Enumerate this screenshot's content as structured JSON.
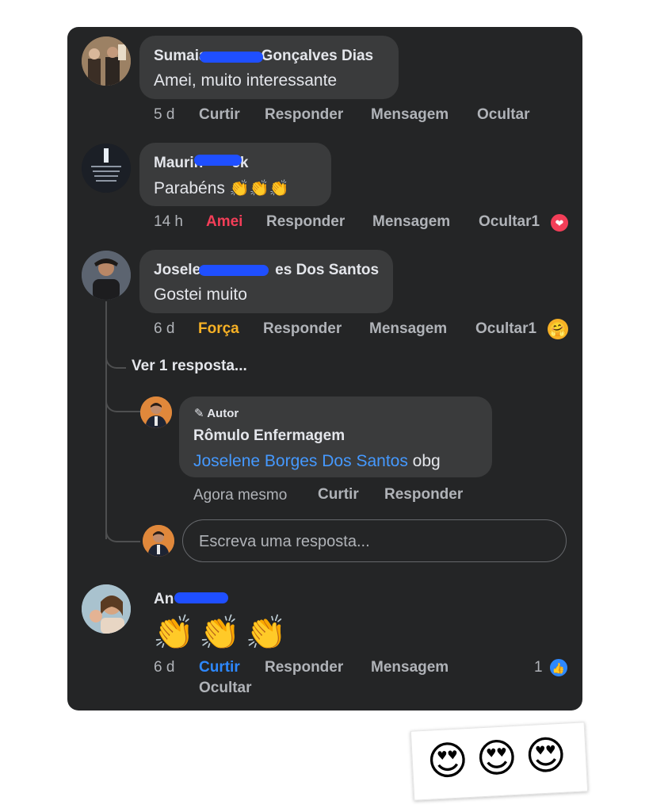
{
  "comments": [
    {
      "author": "Sumaia",
      "author_end": "Gonçalves Dias",
      "text": "Amei, muito interessante",
      "time": "5 d",
      "like_label": "Curtir",
      "reply_label": "Responder",
      "message_label": "Mensagem",
      "hide_label": "Ocultar"
    },
    {
      "author": "Maurin",
      "author_end": "ck",
      "text": "Parabéns",
      "text_emoji": "👏👏👏",
      "time": "14 h",
      "like_label": "Amei",
      "reply_label": "Responder",
      "message_label": "Mensagem",
      "hide_label": "Ocultar",
      "reaction_count": "1",
      "reaction_icon": "heart-icon"
    },
    {
      "author": "Josele",
      "author_end": "es Dos Santos",
      "text": "Gostei muito",
      "time": "6 d",
      "like_label": "Força",
      "reply_label": "Responder",
      "message_label": "Mensagem",
      "hide_label": "Ocultar",
      "reaction_count": "1",
      "reaction_icon": "hug-icon"
    },
    {
      "author": "An",
      "text_emoji": "👏👏👏",
      "time": "6 d",
      "like_label": "Curtir",
      "reply_label": "Responder",
      "message_label": "Mensagem",
      "hide_label": "Ocultar",
      "reaction_count": "1",
      "reaction_icon": "like-icon"
    }
  ],
  "thread": {
    "view_replies": "Ver 1 resposta...",
    "reply": {
      "badge": "Autor",
      "author": "Rômulo Enfermagem",
      "mention": "Joselene Borges Dos Santos",
      "text": "obg",
      "time": "Agora mesmo",
      "like_label": "Curtir",
      "reply_label": "Responder"
    },
    "input_placeholder": "Escreva uma resposta..."
  },
  "sticker_emoji": "😍",
  "colors": {
    "card": "#242526",
    "bubble": "#3a3b3c",
    "amei": "#f33e58",
    "forca": "#f7b125",
    "curtir_active": "#2d88ff",
    "mention": "#4599ff"
  }
}
